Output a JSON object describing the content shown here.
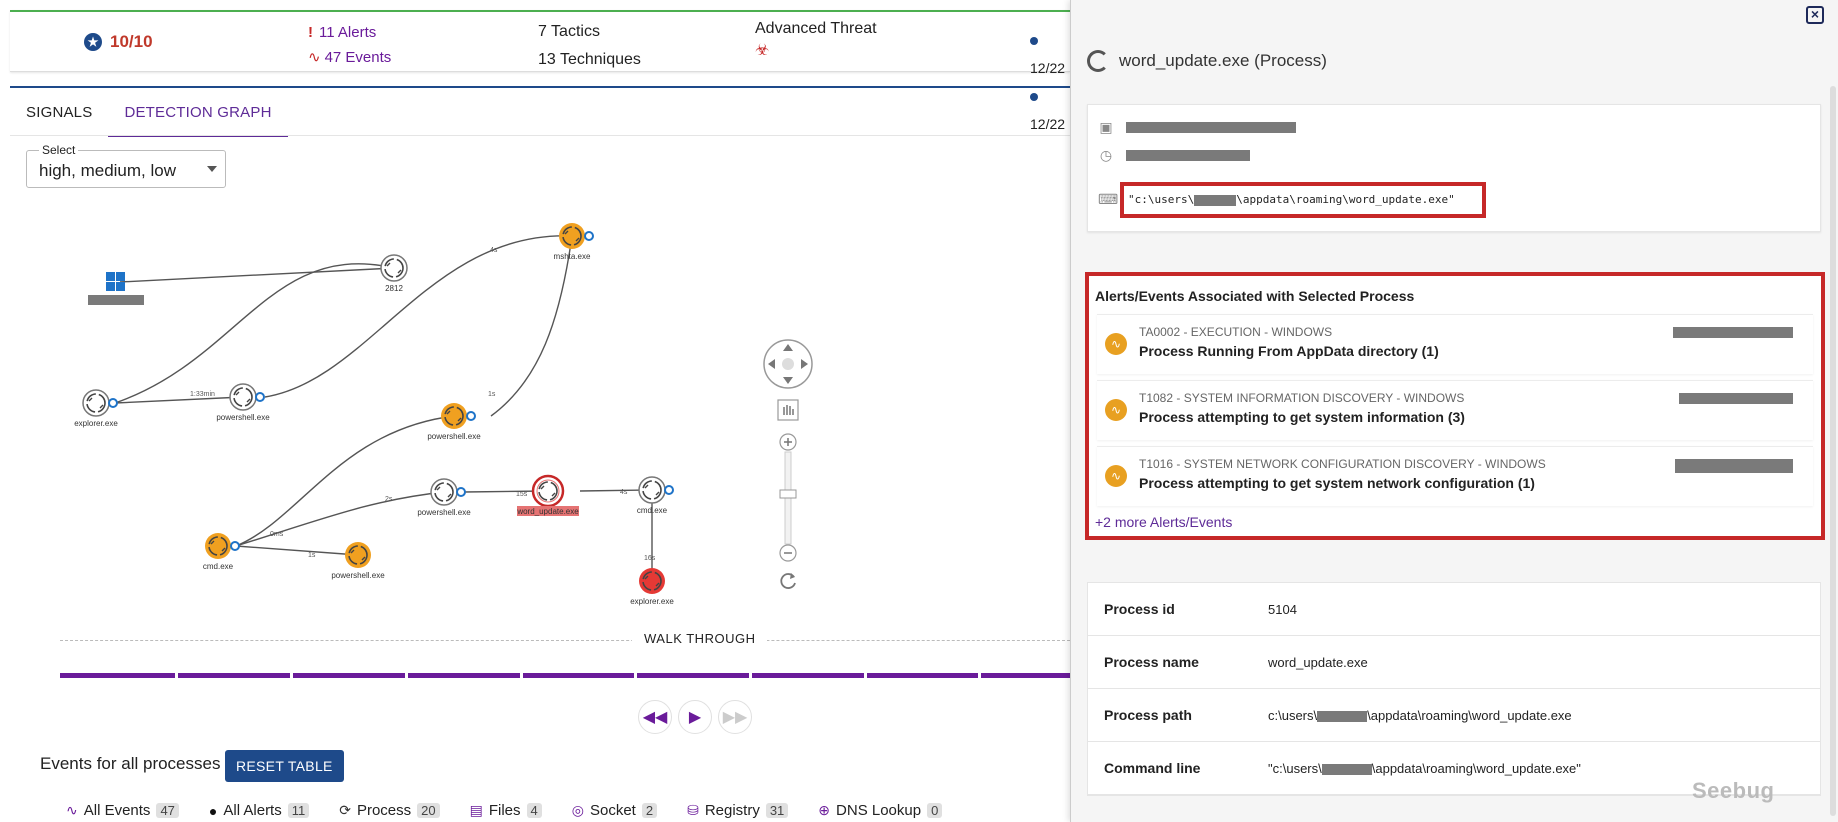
{
  "summary": {
    "score": "10/10",
    "alerts": "11 Alerts",
    "events": "47 Events",
    "tactics": "7 Tactics",
    "techniques": "13 Techniques",
    "threat_type": "Advanced Threat",
    "time_start": "12/22",
    "time_end": "12/22"
  },
  "tabs": [
    {
      "label": "SIGNALS",
      "active": false
    },
    {
      "label": "DETECTION GRAPH",
      "active": true
    }
  ],
  "severity_select": {
    "label": "Select",
    "value": "high, medium, low"
  },
  "graph": {
    "nodes": {
      "n2812": "2812",
      "mshta": "mshta.exe",
      "explorer1": "explorer.exe",
      "powershell1": "powershell.exe",
      "powershell2": "powershell.exe",
      "powershell3": "powershell.exe",
      "word_update": "word_update.exe",
      "cmd2": "cmd.exe",
      "cmd1": "cmd.exe",
      "powershell4": "powershell.exe",
      "explorer2": "explorer.exe"
    },
    "edges": {
      "e1": "1:33min",
      "e2": "4s",
      "e3": "1s",
      "e4": "0ms",
      "e5": "2s",
      "e6": "1s",
      "e7": "15s",
      "e8": "4s",
      "e9": "16s"
    }
  },
  "walkthrough": {
    "label": "WALK THROUGH"
  },
  "events_section": {
    "title": "Events for all processes",
    "reset_label": "RESET TABLE"
  },
  "filters": [
    {
      "label": "All Events",
      "count": "47",
      "icon": "pulse-icon"
    },
    {
      "label": "All Alerts",
      "count": "11",
      "icon": "alert-icon"
    },
    {
      "label": "Process",
      "count": "20",
      "icon": "process-icon"
    },
    {
      "label": "Files",
      "count": "4",
      "icon": "file-icon"
    },
    {
      "label": "Socket",
      "count": "2",
      "icon": "socket-icon"
    },
    {
      "label": "Registry",
      "count": "31",
      "icon": "registry-icon"
    },
    {
      "label": "DNS Lookup",
      "count": "0",
      "icon": "dns-icon"
    }
  ],
  "panel": {
    "title": "word_update.exe (Process)",
    "cmd_prefix": "\"c:\\users\\",
    "cmd_suffix": "\\appdata\\roaming\\word_update.exe\"",
    "alerts_title": "Alerts/Events Associated with Selected Process",
    "alerts": [
      {
        "tag": "TA0002 - EXECUTION - WINDOWS",
        "msg": "Process Running From AppData directory (1)"
      },
      {
        "tag": "T1082 - SYSTEM INFORMATION DISCOVERY - WINDOWS",
        "msg": "Process attempting to get system information (3)"
      },
      {
        "tag": "T1016 - SYSTEM NETWORK CONFIGURATION DISCOVERY - WINDOWS",
        "msg": "Process attempting to get system network configuration (1)"
      }
    ],
    "more_link": "+2 more Alerts/Events",
    "properties": {
      "pid_key": "Process id",
      "pid_val": "5104",
      "name_key": "Process name",
      "name_val": "word_update.exe",
      "path_key": "Process path",
      "path_prefix": "c:\\users\\",
      "path_suffix": "\\appdata\\roaming\\word_update.exe",
      "cmd_key": "Command line",
      "cmd_prefix": "\"c:\\users\\",
      "cmd_suffix": "\\appdata\\roaming\\word_update.exe\""
    }
  },
  "watermark": "Seebug",
  "colors": {
    "accent": "#5e2b97",
    "brand": "#1e4a8a",
    "danger": "#c62828",
    "warn": "#e8a021"
  }
}
